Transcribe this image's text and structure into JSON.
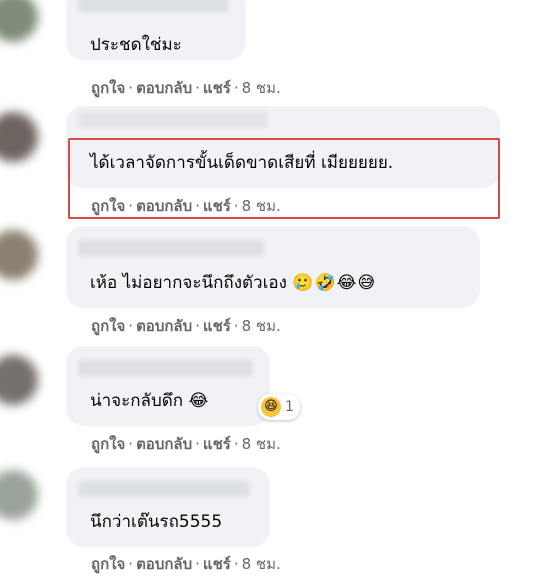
{
  "comments": [
    {
      "text": "ประชดใช่มะ",
      "emojis": "",
      "actions": {
        "like": "ถูกใจ",
        "reply": "ตอบกลับ",
        "share": "แชร์",
        "time": "8 ชม."
      }
    },
    {
      "text": "ได้เวลาจัดการขั้นเด็ดขาดเสียที่ เมียยยยย.",
      "emojis": "",
      "actions": {
        "like": "ถูกใจ",
        "reply": "ตอบกลับ",
        "share": "แชร์",
        "time": "8 ชม."
      }
    },
    {
      "text": "เห้อ ไม่อยากจะนึกถึงตัวเอง",
      "emojis": "🥲🤣😂😅",
      "actions": {
        "like": "ถูกใจ",
        "reply": "ตอบกลับ",
        "share": "แชร์",
        "time": "8 ชม."
      }
    },
    {
      "text": "น่าจะกลับดึก",
      "emojis": "😂",
      "reaction": {
        "icon": "laughing-face",
        "count": "1"
      },
      "actions": {
        "like": "ถูกใจ",
        "reply": "ตอบกลับ",
        "share": "แชร์",
        "time": "8 ชม."
      }
    },
    {
      "text": "นึกว่าเต๊นรถ5555",
      "emojis": "",
      "actions": {
        "like": "ถูกใจ",
        "reply": "ตอบกลับ",
        "share": "แชร์",
        "time": "8 ชม."
      }
    }
  ],
  "separator": "·",
  "colors": {
    "bubble": "#f0f2f5",
    "highlight": "#d9474b",
    "meta": "#65676b",
    "text": "#050505"
  }
}
